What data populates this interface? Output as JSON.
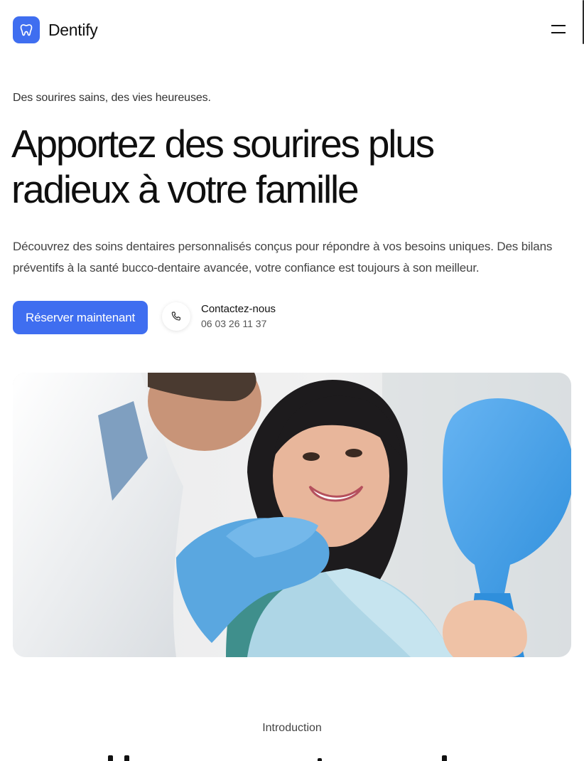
{
  "header": {
    "brand_name": "Dentify",
    "logo_icon": "tooth-icon",
    "menu_icon": "hamburger-menu-icon"
  },
  "hero": {
    "tagline": "Des sourires sains, des vies heureuses.",
    "title": "Apportez des sourires plus radieux à votre famille",
    "description": "Découvrez des soins dentaires personnalisés conçus pour répondre à vos besoins uniques. Des bilans préventifs à la santé bucco-dentaire avancée, votre confiance est toujours à son meilleur.",
    "cta_label": "Réserver maintenant",
    "contact": {
      "label": "Contactez-nous",
      "phone": "06 03 26 11 37",
      "icon": "phone-icon"
    }
  },
  "intro": {
    "eyebrow": "Introduction"
  },
  "colors": {
    "accent": "#3f6ef0",
    "text": "#111111",
    "muted": "#444444"
  }
}
